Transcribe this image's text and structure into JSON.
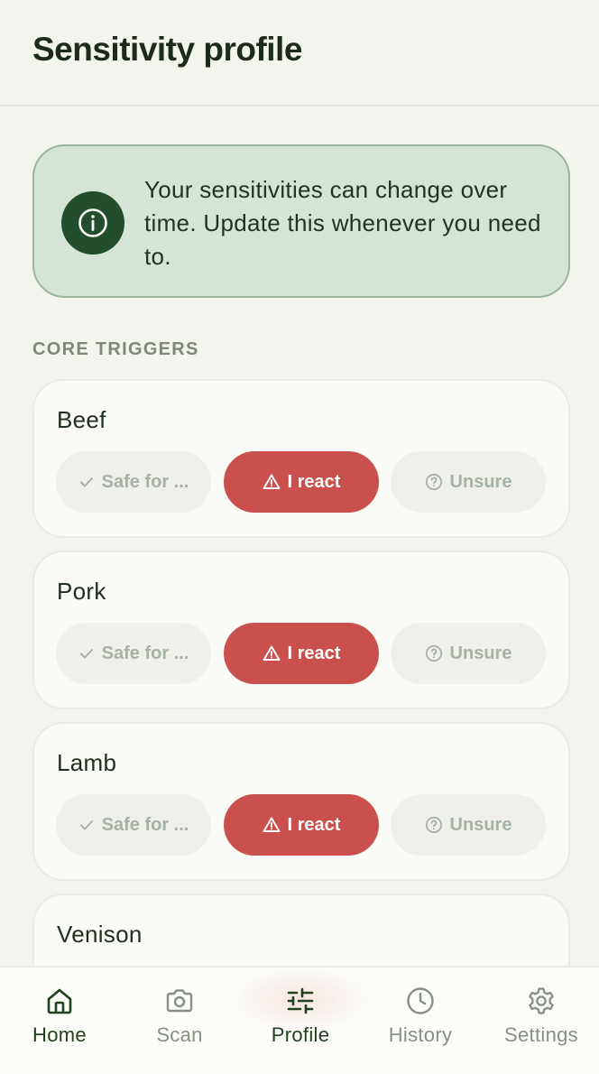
{
  "header": {
    "title": "Sensitivity profile"
  },
  "info_banner": {
    "icon": "info-icon",
    "text": "Your sensitivities can change over time. Update this whenever you need to."
  },
  "section": {
    "title": "CORE TRIGGERS"
  },
  "triggers": [
    {
      "name": "Beef",
      "selected": "react",
      "options": {
        "safe": "Safe for ...",
        "react": "I react",
        "unsure": "Unsure"
      }
    },
    {
      "name": "Pork",
      "selected": "react",
      "options": {
        "safe": "Safe for ...",
        "react": "I react",
        "unsure": "Unsure"
      }
    },
    {
      "name": "Lamb",
      "selected": "react",
      "options": {
        "safe": "Safe for ...",
        "react": "I react",
        "unsure": "Unsure"
      }
    },
    {
      "name": "Venison"
    }
  ],
  "nav": {
    "active": "Profile",
    "items": [
      {
        "label": "Home",
        "icon": "home-icon"
      },
      {
        "label": "Scan",
        "icon": "camera-icon"
      },
      {
        "label": "Profile",
        "icon": "sliders-icon"
      },
      {
        "label": "History",
        "icon": "clock-icon"
      },
      {
        "label": "Settings",
        "icon": "gear-icon"
      }
    ]
  },
  "colors": {
    "accent_green": "#234e2d",
    "react_red": "#c9504c",
    "banner_bg": "#d5e4d6"
  }
}
